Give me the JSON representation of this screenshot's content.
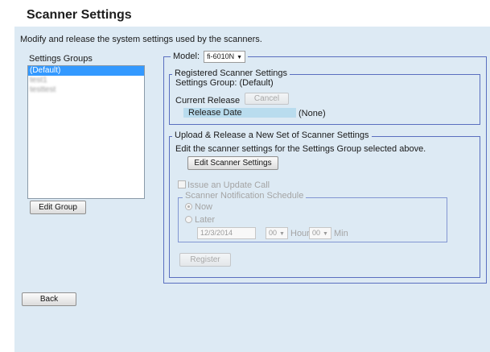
{
  "header": {
    "title": "Scanner Settings"
  },
  "description": "Modify and release the system settings used by the scanners.",
  "groups": {
    "label": "Settings Groups",
    "items": [
      {
        "label": "(Default)",
        "selected": true,
        "blurred": false
      },
      {
        "label": "test1",
        "selected": false,
        "blurred": true
      },
      {
        "label": "testtest",
        "selected": false,
        "blurred": true
      }
    ],
    "edit_button": "Edit Group"
  },
  "model": {
    "label": "Model:",
    "value": "fi-6010N"
  },
  "registered": {
    "legend": "Registered Scanner Settings",
    "settings_group_text": "Settings Group: (Default)",
    "current_release_label": "Current Release",
    "cancel_button": "Cancel",
    "release_date_label": "Release Date",
    "release_date_value": "(None)"
  },
  "upload": {
    "legend": "Upload & Release a New Set of Scanner Settings",
    "description": "Edit the scanner settings for the Settings Group selected above.",
    "edit_button": "Edit Scanner Settings",
    "issue_update_label": "Issue an Update Call",
    "schedule": {
      "legend": "Scanner Notification Schedule",
      "now_label": "Now",
      "later_label": "Later",
      "date_value": "12/3/2014",
      "hour_value": "00",
      "hour_label": "Hour",
      "min_value": "00",
      "min_label": "Min"
    },
    "register_button": "Register"
  },
  "back_button": "Back",
  "colors": {
    "page_bg": "#ddeaf4",
    "frame_border": "#5a6fbf",
    "selection": "#3399ff",
    "release_highlight": "#b9dcee"
  }
}
